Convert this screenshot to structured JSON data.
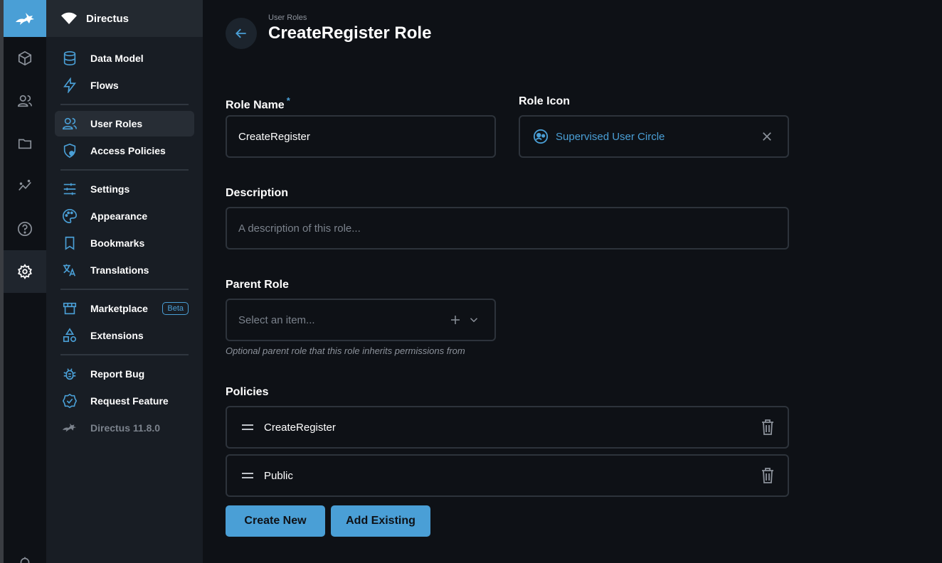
{
  "app": {
    "title": "Directus"
  },
  "nav": {
    "items": [
      {
        "label": "Data Model",
        "icon": "database-icon"
      },
      {
        "label": "Flows",
        "icon": "bolt-icon"
      },
      {
        "label": "User Roles",
        "icon": "users-icon",
        "active": true
      },
      {
        "label": "Access Policies",
        "icon": "shield-lock-icon"
      },
      {
        "label": "Settings",
        "icon": "sliders-icon"
      },
      {
        "label": "Appearance",
        "icon": "palette-icon"
      },
      {
        "label": "Bookmarks",
        "icon": "bookmark-icon"
      },
      {
        "label": "Translations",
        "icon": "translate-icon"
      },
      {
        "label": "Marketplace",
        "icon": "storefront-icon",
        "badge": "Beta"
      },
      {
        "label": "Extensions",
        "icon": "shapes-icon"
      },
      {
        "label": "Report Bug",
        "icon": "bug-icon"
      },
      {
        "label": "Request Feature",
        "icon": "verified-icon"
      },
      {
        "label": "Directus 11.8.0",
        "icon": "directus-logo-icon"
      }
    ]
  },
  "header": {
    "breadcrumb": "User Roles",
    "title": "CreateRegister Role"
  },
  "form": {
    "role_name": {
      "label": "Role Name",
      "required_mark": "*",
      "value": "CreateRegister"
    },
    "role_icon": {
      "label": "Role Icon",
      "value": "Supervised User Circle"
    },
    "description": {
      "label": "Description",
      "placeholder": "A description of this role..."
    },
    "parent_role": {
      "label": "Parent Role",
      "placeholder": "Select an item...",
      "hint": "Optional parent role that this role inherits permissions from"
    },
    "policies": {
      "label": "Policies",
      "items": [
        "CreateRegister",
        "Public"
      ],
      "create_label": "Create New",
      "add_label": "Add Existing"
    }
  },
  "colors": {
    "accent": "#4a9fd6",
    "background": "#0e1116",
    "sidebar": "#181d24"
  }
}
